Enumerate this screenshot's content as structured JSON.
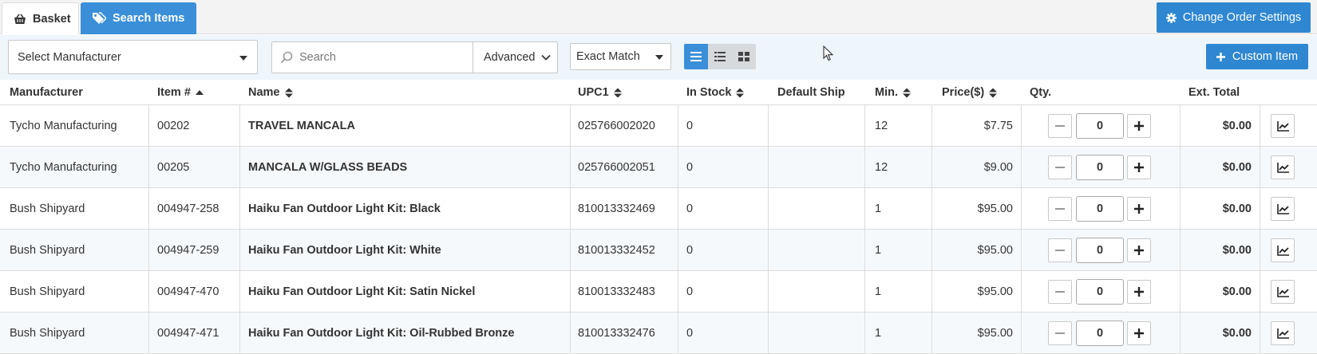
{
  "tabs": {
    "basket": "Basket",
    "search_items": "Search Items"
  },
  "order_settings_label": "Change Order Settings",
  "toolbar": {
    "manufacturer_select": "Select Manufacturer",
    "search_placeholder": "Search",
    "advanced_label": "Advanced",
    "match_mode": "Exact Match",
    "custom_item_label": "Custom Item",
    "active_view": "list"
  },
  "columns": {
    "manufacturer": "Manufacturer",
    "item": "Item #",
    "name": "Name",
    "upc": "UPC1",
    "in_stock": "In Stock",
    "default_ship": "Default Ship",
    "min": "Min.",
    "price": "Price($)",
    "qty": "Qty.",
    "ext_total": "Ext. Total"
  },
  "rows": [
    {
      "manufacturer": "Tycho Manufacturing",
      "item": "00202",
      "name": "TRAVEL MANCALA",
      "upc": "025766002020",
      "in_stock": "0",
      "default_ship": "",
      "min": "12",
      "price": "$7.75",
      "qty": "0",
      "ext_total": "$0.00"
    },
    {
      "manufacturer": "Tycho Manufacturing",
      "item": "00205",
      "name": "MANCALA W/GLASS BEADS",
      "upc": "025766002051",
      "in_stock": "0",
      "default_ship": "",
      "min": "12",
      "price": "$9.00",
      "qty": "0",
      "ext_total": "$0.00"
    },
    {
      "manufacturer": "Bush Shipyard",
      "item": "004947-258",
      "name": "Haiku Fan Outdoor Light Kit: Black",
      "upc": "810013332469",
      "in_stock": "0",
      "default_ship": "",
      "min": "1",
      "price": "$95.00",
      "qty": "0",
      "ext_total": "$0.00"
    },
    {
      "manufacturer": "Bush Shipyard",
      "item": "004947-259",
      "name": "Haiku Fan Outdoor Light Kit: White",
      "upc": "810013332452",
      "in_stock": "0",
      "default_ship": "",
      "min": "1",
      "price": "$95.00",
      "qty": "0",
      "ext_total": "$0.00"
    },
    {
      "manufacturer": "Bush Shipyard",
      "item": "004947-470",
      "name": "Haiku Fan Outdoor Light Kit: Satin Nickel",
      "upc": "810013332483",
      "in_stock": "0",
      "default_ship": "",
      "min": "1",
      "price": "$95.00",
      "qty": "0",
      "ext_total": "$0.00"
    },
    {
      "manufacturer": "Bush Shipyard",
      "item": "004947-471",
      "name": "Haiku Fan Outdoor Light Kit: Oil-Rubbed Bronze",
      "upc": "810013332476",
      "in_stock": "0",
      "default_ship": "",
      "min": "1",
      "price": "$95.00",
      "qty": "0",
      "ext_total": "$0.00"
    }
  ],
  "colors": {
    "primary": "#2f87d1",
    "tab_active": "#3a8fd8",
    "toolbar_bg": "#eef5fb",
    "row_alt": "#f6f9fc"
  }
}
